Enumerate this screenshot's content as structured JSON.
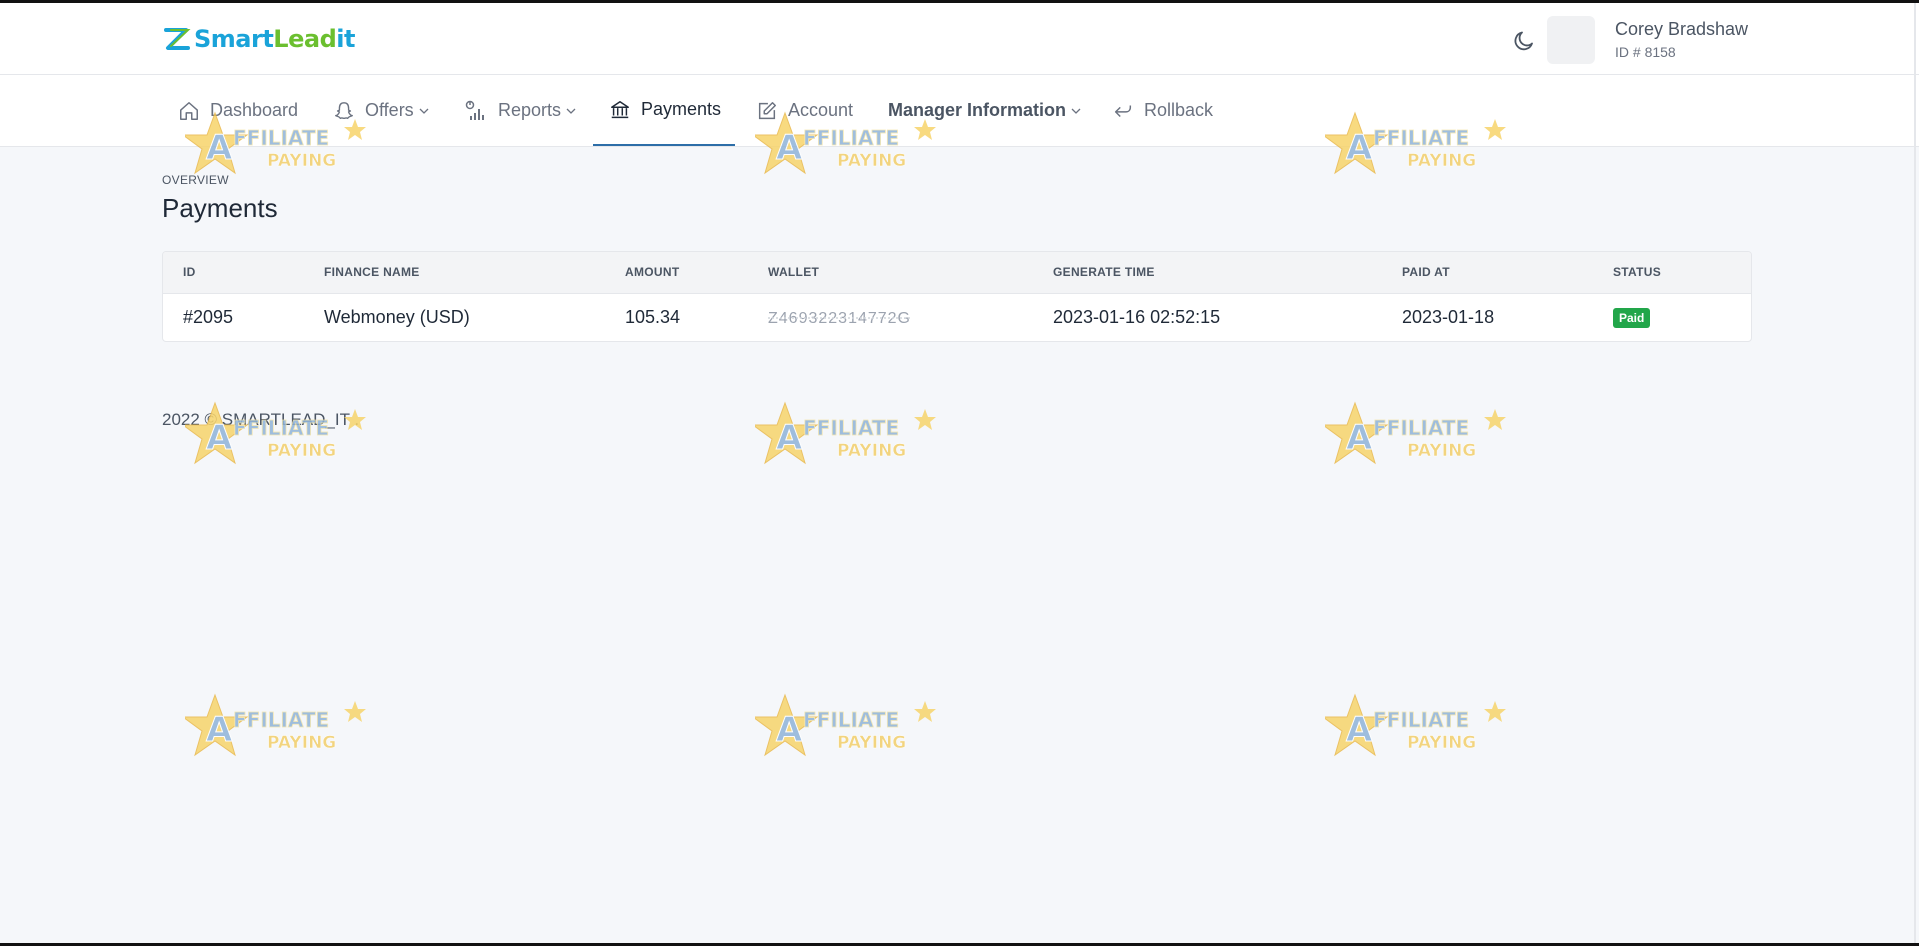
{
  "brand": {
    "logo_text_smart": "Smart",
    "logo_text_lead": "Lead",
    "logo_text_it": "it",
    "colors": {
      "blue": "#1aa3d9",
      "green": "#6bbf2f"
    }
  },
  "header": {
    "user_name": "Corey Bradshaw",
    "user_id": "ID # 8158",
    "theme_icon": "moon-icon"
  },
  "nav": {
    "items": [
      {
        "label": "Dashboard",
        "icon": "home-icon"
      },
      {
        "label": "Offers",
        "icon": "snapchat-icon"
      },
      {
        "label": "Reports",
        "icon": "chart-icon"
      },
      {
        "label": "Payments",
        "icon": "bank-icon"
      },
      {
        "label": "Account",
        "icon": "edit-icon"
      },
      {
        "label": "Manager Information"
      },
      {
        "label": "Rollback",
        "icon": "return-icon"
      }
    ],
    "active_color": "#2d6ea8"
  },
  "page": {
    "overview": "OVERVIEW",
    "title": "Payments"
  },
  "table": {
    "columns": [
      "ID",
      "FINANCE NAME",
      "AMOUNT",
      "WALLET",
      "GENERATE TIME",
      "PAID AT",
      "STATUS"
    ],
    "rows": [
      {
        "id": "#2095",
        "finance_name": "Webmoney (USD)",
        "amount": "105.34",
        "wallet": "Z469322314772G",
        "generate_time": "2023-01-16 02:52:15",
        "paid_at": "2023-01-18",
        "status": "Paid"
      }
    ],
    "status_color": "#22a64a"
  },
  "footer": {
    "text": "2022 © SMARTLEAD_IT ."
  },
  "watermark": {
    "line1": "AFFILIATE",
    "line2": "PAYING"
  }
}
